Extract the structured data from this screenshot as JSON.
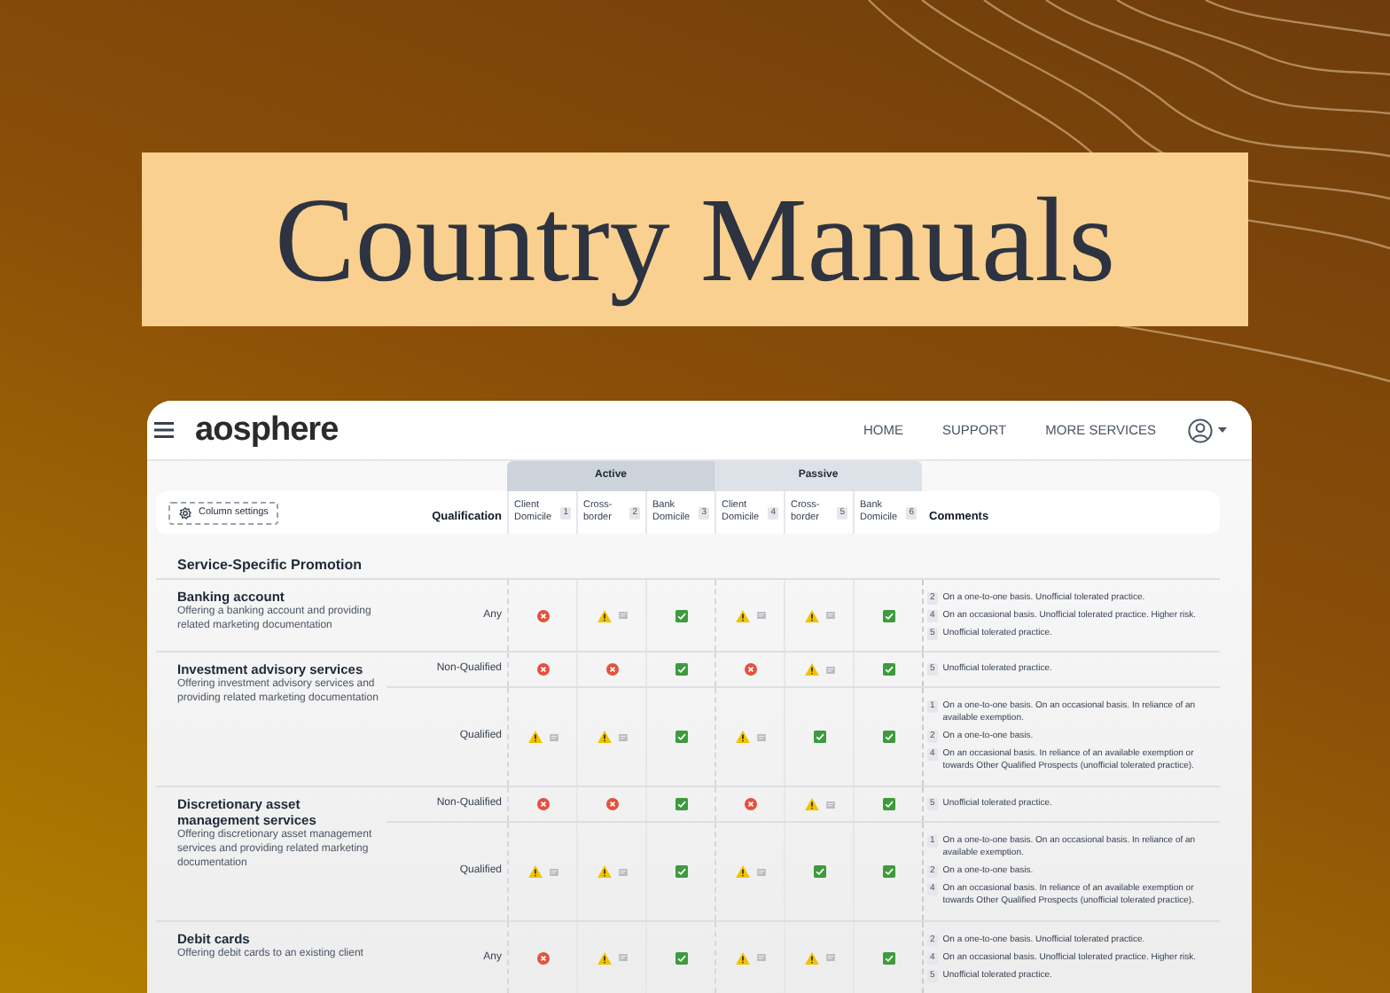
{
  "banner": {
    "title": "Country Manuals"
  },
  "app": {
    "logo": "aosphere",
    "nav": [
      "HOME",
      "SUPPORT",
      "MORE SERVICES"
    ],
    "groups": [
      {
        "label": "Active"
      },
      {
        "label": "Passive"
      }
    ],
    "column_settings": "Column settings",
    "qualification_header": "Qualification",
    "comments_header": "Comments",
    "columns": [
      {
        "label": "Client Domicile",
        "number": "1"
      },
      {
        "label": "Cross-border",
        "number": "2"
      },
      {
        "label": "Bank Domicile",
        "number": "3"
      },
      {
        "label": "Client Domicile",
        "number": "4"
      },
      {
        "label": "Cross-border",
        "number": "5"
      },
      {
        "label": "Bank Domicile",
        "number": "6"
      }
    ],
    "section": "Service-Specific Promotion",
    "services": [
      {
        "title": "Banking account",
        "description": "Offering a banking account and providing related marketing documentation",
        "rows": [
          {
            "qualification": "Any",
            "cells": [
              {
                "kind": "no"
              },
              {
                "kind": "warn"
              },
              {
                "kind": "yes"
              },
              {
                "kind": "warn"
              },
              {
                "kind": "warn"
              },
              {
                "kind": "yes"
              }
            ],
            "comments": [
              {
                "number": "2",
                "text": "On a one-to-one basis. Unofficial tolerated practice."
              },
              {
                "number": "4",
                "text": "On an occasional basis. Unofficial tolerated practice. Higher risk."
              },
              {
                "number": "5",
                "text": "Unofficial tolerated practice."
              }
            ]
          }
        ]
      },
      {
        "title": "Investment advisory services",
        "description": "Offering investment advisory services and providing related marketing documentation",
        "rows": [
          {
            "qualification": "Non-Qualified",
            "cells": [
              {
                "kind": "no"
              },
              {
                "kind": "no"
              },
              {
                "kind": "yes"
              },
              {
                "kind": "no"
              },
              {
                "kind": "warn"
              },
              {
                "kind": "yes"
              }
            ],
            "comments": [
              {
                "number": "5",
                "text": "Unofficial tolerated practice."
              }
            ]
          },
          {
            "qualification": "Qualified",
            "cells": [
              {
                "kind": "warn"
              },
              {
                "kind": "warn"
              },
              {
                "kind": "yes"
              },
              {
                "kind": "warn"
              },
              {
                "kind": "yes"
              },
              {
                "kind": "yes"
              }
            ],
            "comments": [
              {
                "number": "1",
                "text": "On a one-to-one basis. On an occasional basis. In reliance of an available exemption."
              },
              {
                "number": "2",
                "text": "On a one-to-one basis."
              },
              {
                "number": "4",
                "text": "On an occasional basis. In reliance of an available exemption or towards Other Qualified Prospects (unofficial tolerated practice)."
              }
            ]
          }
        ]
      },
      {
        "title": "Discretionary asset management services",
        "description": "Offering discretionary asset management services and providing related marketing documentation",
        "rows": [
          {
            "qualification": "Non-Qualified",
            "cells": [
              {
                "kind": "no"
              },
              {
                "kind": "no"
              },
              {
                "kind": "yes"
              },
              {
                "kind": "no"
              },
              {
                "kind": "warn"
              },
              {
                "kind": "yes"
              }
            ],
            "comments": [
              {
                "number": "5",
                "text": "Unofficial tolerated practice."
              }
            ]
          },
          {
            "qualification": "Qualified",
            "cells": [
              {
                "kind": "warn"
              },
              {
                "kind": "warn"
              },
              {
                "kind": "yes"
              },
              {
                "kind": "warn"
              },
              {
                "kind": "yes"
              },
              {
                "kind": "yes"
              }
            ],
            "comments": [
              {
                "number": "1",
                "text": "On a one-to-one basis. On an occasional basis. In reliance of an available exemption."
              },
              {
                "number": "2",
                "text": "On a one-to-one basis."
              },
              {
                "number": "4",
                "text": "On an occasional basis. In reliance of an available exemption or towards Other Qualified Prospects (unofficial tolerated practice)."
              }
            ]
          }
        ]
      },
      {
        "title": "Debit cards",
        "description": "Offering debit cards to an existing client",
        "rows": [
          {
            "qualification": "Any",
            "cells": [
              {
                "kind": "no"
              },
              {
                "kind": "warn"
              },
              {
                "kind": "yes"
              },
              {
                "kind": "warn"
              },
              {
                "kind": "warn"
              },
              {
                "kind": "yes"
              }
            ],
            "comments": [
              {
                "number": "2",
                "text": "On a one-to-one basis. Unofficial tolerated practice."
              },
              {
                "number": "4",
                "text": "On an occasional basis. Unofficial tolerated practice. Higher risk."
              },
              {
                "number": "5",
                "text": "Unofficial tolerated practice."
              }
            ]
          }
        ]
      }
    ]
  }
}
